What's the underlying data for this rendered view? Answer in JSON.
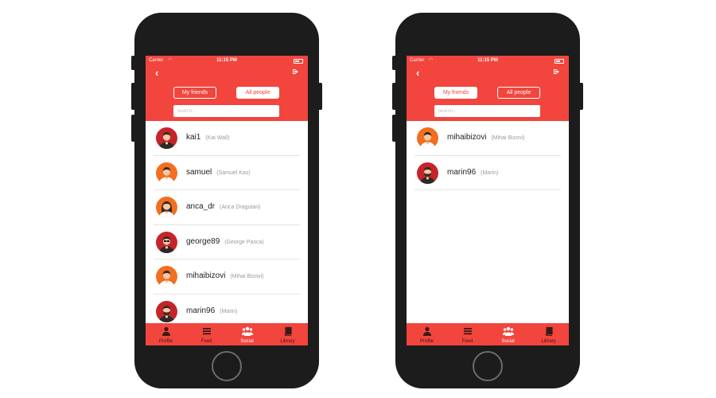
{
  "status": {
    "carrier": "Carrier",
    "time": "11:15 PM"
  },
  "segments": {
    "friends": "My friends",
    "all": "All people"
  },
  "search": {
    "placeholder": "Search..."
  },
  "tabs": {
    "profile": "Profile",
    "feed": "Feed",
    "social": "Social",
    "library": "Library"
  },
  "colors": {
    "accent": "#f2453d",
    "avatar_red": "#c5242a",
    "avatar_orange": "#f26e21"
  },
  "left_screen": {
    "active_segment": "all",
    "people": [
      {
        "username": "kai1",
        "fullname": "(Kai Wall)",
        "avatar": "red-male"
      },
      {
        "username": "samuel",
        "fullname": "(Samuel Kas)",
        "avatar": "orange-male"
      },
      {
        "username": "anca_dr",
        "fullname": "(Anca Dragutan)",
        "avatar": "orange-female"
      },
      {
        "username": "george89",
        "fullname": "(George Pasca)",
        "avatar": "red-male-glasses"
      },
      {
        "username": "mihaibizovi",
        "fullname": "(Mihai Bizovi)",
        "avatar": "orange-male"
      },
      {
        "username": "marin96",
        "fullname": "(Marin)",
        "avatar": "red-male-beard"
      }
    ]
  },
  "right_screen": {
    "active_segment": "friends",
    "people": [
      {
        "username": "mihaibizovi",
        "fullname": "(Mihai Bizovi)",
        "avatar": "orange-male"
      },
      {
        "username": "marin96",
        "fullname": "(Marin)",
        "avatar": "red-male-beard"
      }
    ]
  }
}
